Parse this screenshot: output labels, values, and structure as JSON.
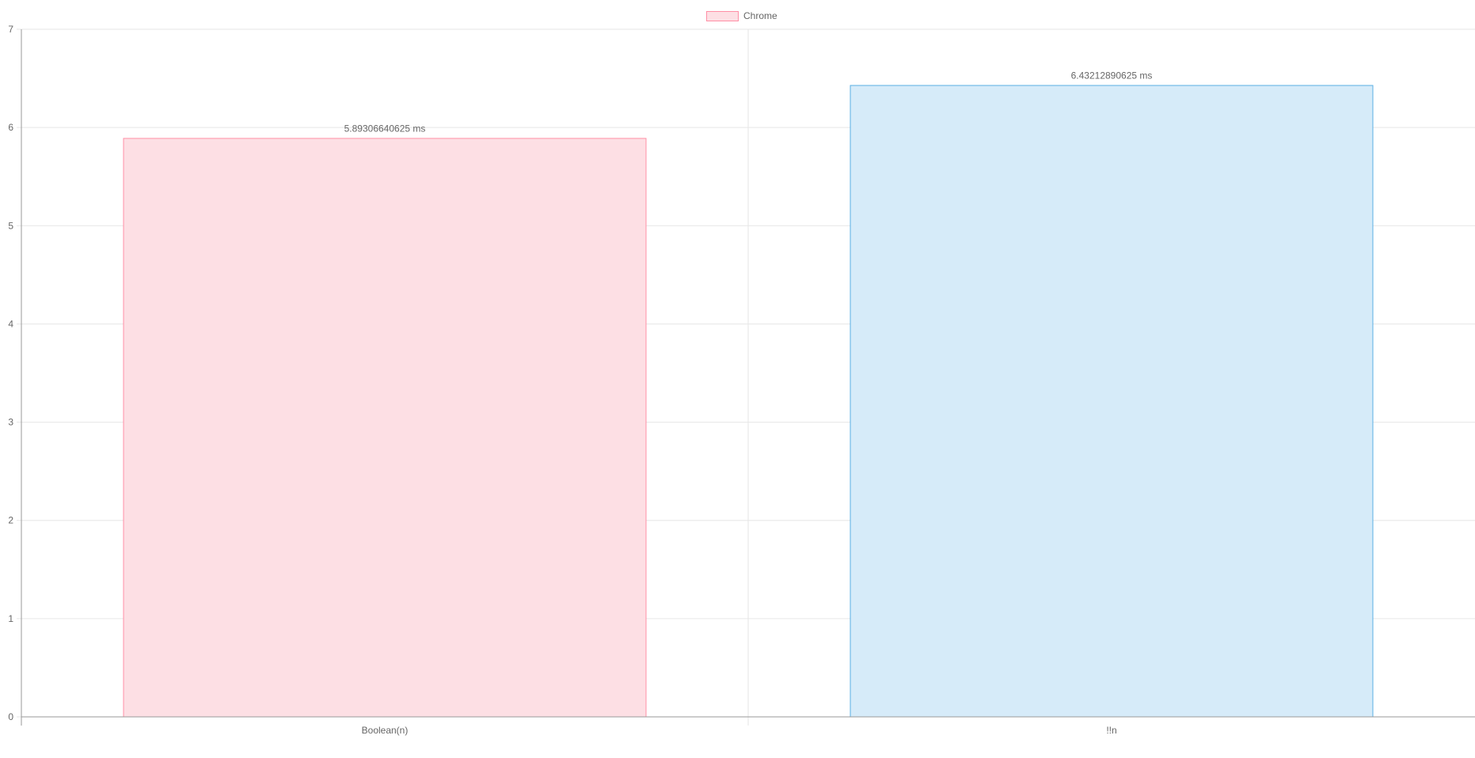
{
  "chart_data": {
    "type": "bar",
    "categories": [
      "Boolean(n)",
      "!!n"
    ],
    "series": [
      {
        "name": "Chrome",
        "values": [
          5.89306640625,
          6.43212890625
        ]
      }
    ],
    "data_labels": [
      "5.89306640625 ms",
      "6.43212890625 ms"
    ],
    "yticks": [
      "0",
      "1",
      "2",
      "3",
      "4",
      "5",
      "6",
      "7"
    ],
    "ylim": [
      0,
      7
    ],
    "legend_position": "top-center",
    "grid": true,
    "colors": {
      "bar_fills": [
        "#fddfe4",
        "#d6ebf9"
      ],
      "bar_borders": [
        "#ff8fa6",
        "#5aafe3"
      ],
      "grid": "#e6e6e6",
      "axis": "#9a9a9a",
      "text": "#666666"
    }
  }
}
